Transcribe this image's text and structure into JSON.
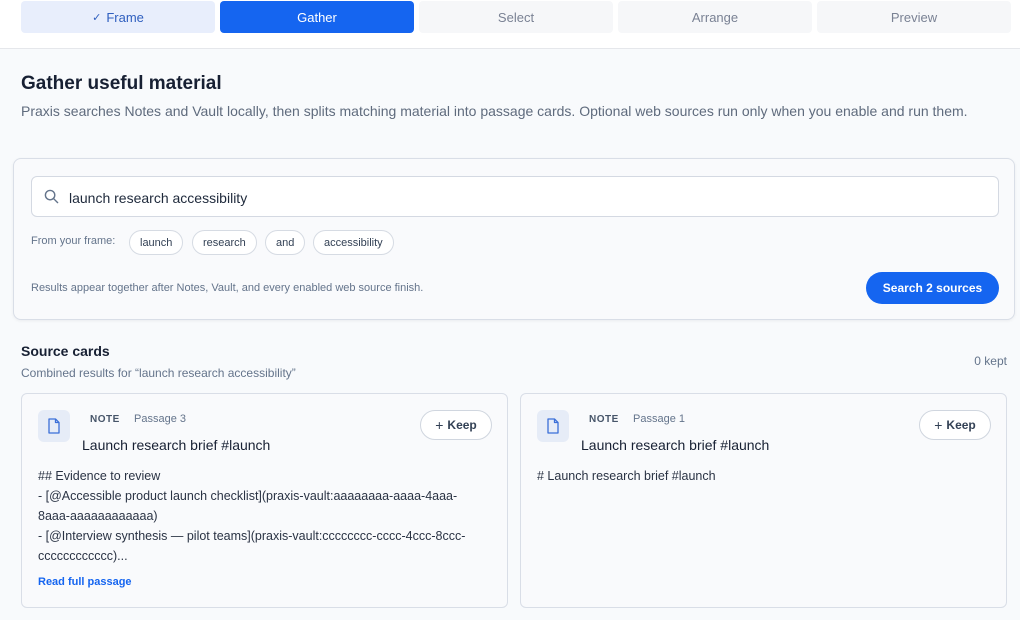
{
  "stepper": {
    "steps": [
      {
        "label": "Frame",
        "state": "done"
      },
      {
        "label": "Gather",
        "state": "active"
      },
      {
        "label": "Select",
        "state": "pending"
      },
      {
        "label": "Arrange",
        "state": "pending"
      },
      {
        "label": "Preview",
        "state": "pending"
      }
    ]
  },
  "page": {
    "title": "Gather useful material",
    "intro": "Praxis searches Notes and Vault locally, then splits matching material into passage cards. Optional web sources run only when you enable and run them."
  },
  "search": {
    "query": "launch research accessibility",
    "frame_label": "From your frame:",
    "chips": [
      "launch",
      "research",
      "and",
      "accessibility"
    ],
    "note": "Results appear together after Notes, Vault, and every enabled web source finish.",
    "button_label": "Search 2 sources"
  },
  "sources": {
    "title": "Source cards",
    "subtitle": "Combined results for “launch research accessibility”",
    "kept": "0 kept",
    "cards": [
      {
        "badge": "NOTE",
        "passage": "Passage 3",
        "title": "Launch research brief #launch",
        "keep_label": "Keep",
        "body": "## Evidence to review\n- [@Accessible product launch checklist](praxis-vault:aaaaaaaa-aaaa-4aaa-8aaa-aaaaaaaaaaaa)\n- [@Interview synthesis — pilot teams](praxis-vault:cccccccc-cccc-4ccc-8ccc-cccccccccccc)...",
        "link": "Read full passage"
      },
      {
        "badge": "NOTE",
        "passage": "Passage 1",
        "title": "Launch research brief #launch",
        "keep_label": "Keep",
        "body": "# Launch research brief #launch",
        "link": ""
      }
    ]
  },
  "colors": {
    "accent": "#1565f0",
    "done_step_bg": "#e8eefc",
    "background": "#f8fafc"
  },
  "icons": {
    "done_step": "check-icon",
    "search": "search-icon",
    "card": "document-icon",
    "keep": "plus-icon"
  }
}
